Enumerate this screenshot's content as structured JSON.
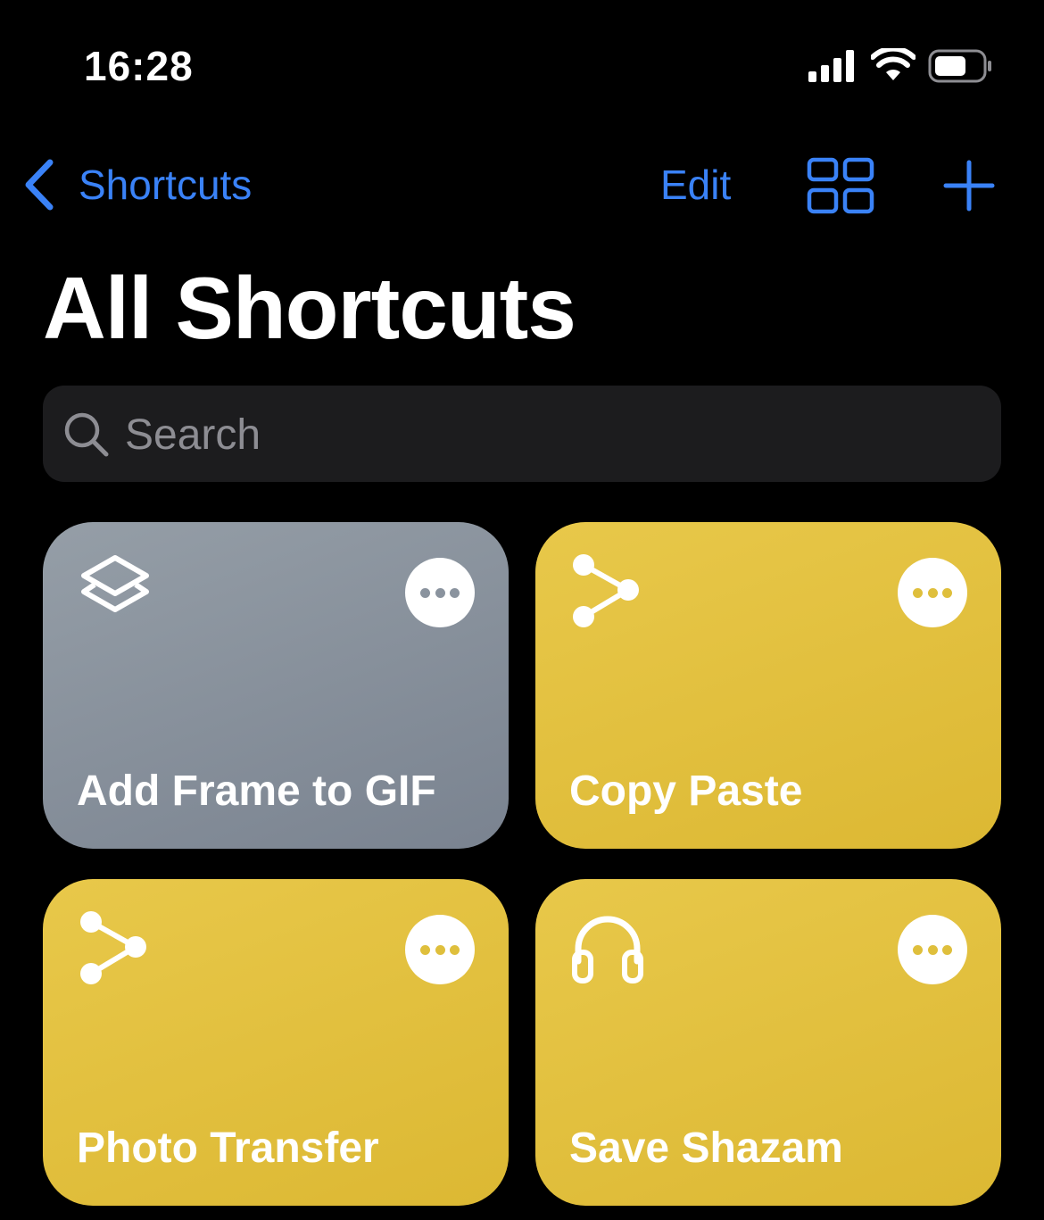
{
  "status_bar": {
    "time": "16:28",
    "icons": [
      "cellular-signal-icon",
      "wifi-icon",
      "battery-icon"
    ]
  },
  "nav": {
    "back_label": "Shortcuts",
    "edit_label": "Edit",
    "accent_color": "#3a82f7"
  },
  "title": "All Shortcuts",
  "search": {
    "placeholder": "Search",
    "value": ""
  },
  "shortcuts": [
    {
      "label": "Add Frame to GIF",
      "color": "gray",
      "icon": "layers-icon"
    },
    {
      "label": "Copy Paste",
      "color": "yellow",
      "icon": "share-nodes-icon"
    },
    {
      "label": "Photo Transfer",
      "color": "yellow",
      "icon": "share-nodes-icon"
    },
    {
      "label": "Save Shazam",
      "color": "yellow",
      "icon": "headphones-icon"
    }
  ]
}
